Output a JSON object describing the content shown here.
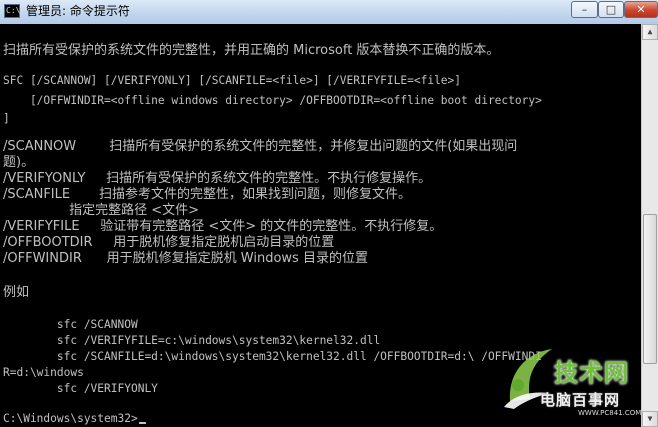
{
  "window": {
    "title": "管理员: 命令提示符",
    "icon_text": "C:\\",
    "minimize_icon": "–",
    "maximize_icon": "□",
    "close_icon": "✕"
  },
  "console": {
    "lines": [
      "扫描所有受保护的系统文件的完整性，并用正确的 Microsoft 版本替换不正确的版本。",
      "SFC [/SCANNOW] [/VERIFYONLY] [/SCANFILE=<file>] [/VERIFYFILE=<file>]",
      "    [/OFFWINDIR=<offline windows directory> /OFFBOOTDIR=<offline boot directory>",
      "]",
      "/SCANNOW        扫描所有受保护的系统文件的完整性，并修复出问题的文件(如果出现问",
      "题)。",
      "/VERIFYONLY     扫描所有受保护的系统文件的完整性。不执行修复操作。",
      "/SCANFILE       扫描参考文件的完整性，如果找到问题，则修复文件。",
      "                指定完整路径 <文件>",
      "/VERIFYFILE     验证带有完整路径 <文件> 的文件的完整性。不执行修复。",
      "/OFFBOOTDIR     用于脱机修复指定脱机启动目录的位置",
      "/OFFWINDIR      用于脱机修复指定脱机 Windows 目录的位置",
      "例如",
      "        sfc /SCANNOW",
      "        sfc /VERIFYFILE=c:\\windows\\system32\\kernel32.dll",
      "        sfc /SCANFILE=d:\\windows\\system32\\kernel32.dll /OFFBOOTDIR=d:\\ /OFFWINDI",
      "R=d:\\windows",
      "        sfc /VERIFYONLY",
      "C:\\Windows\\system32>"
    ]
  },
  "scrollbar": {
    "up_icon": "▲",
    "down_icon": "▼"
  },
  "watermark": {
    "main_text": "技术网",
    "brand_text": "电脑百事网",
    "url_text": "WWW.PC841.COM"
  }
}
